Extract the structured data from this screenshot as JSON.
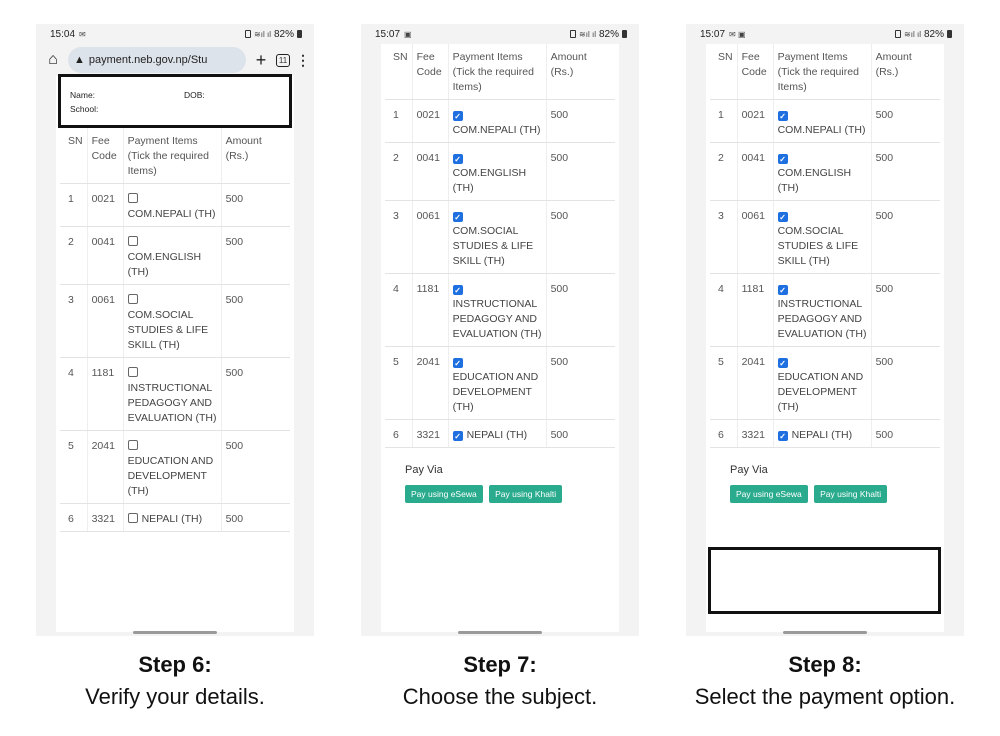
{
  "phone1": {
    "status": {
      "time": "15:04",
      "battery": "82%"
    },
    "browser": {
      "url": "payment.neb.gov.np/Stu",
      "tab_count": "11"
    },
    "info": {
      "name_label": "Name:",
      "dob_label": "DOB:",
      "school_label": "School:"
    },
    "table": {
      "headers": {
        "sn": "SN",
        "code": "Fee Code",
        "item": "Payment Items (Tick the required Items)",
        "amount": "Amount (Rs.)"
      },
      "rows": [
        {
          "sn": "1",
          "code": "0021",
          "item": "COM.NEPALI (TH)",
          "amount": "500",
          "checked": false
        },
        {
          "sn": "2",
          "code": "0041",
          "item": "COM.ENGLISH (TH)",
          "amount": "500",
          "checked": false
        },
        {
          "sn": "3",
          "code": "0061",
          "item": "COM.SOCIAL STUDIES & LIFE SKILL (TH)",
          "amount": "500",
          "checked": false
        },
        {
          "sn": "4",
          "code": "1181",
          "item": "INSTRUCTIONAL PEDAGOGY AND EVALUATION (TH)",
          "amount": "500",
          "checked": false
        },
        {
          "sn": "5",
          "code": "2041",
          "item": "EDUCATION AND DEVELOPMENT (TH)",
          "amount": "500",
          "checked": false
        },
        {
          "sn": "6",
          "code": "3321",
          "item": "NEPALI (TH)",
          "amount": "500",
          "checked": false
        }
      ]
    }
  },
  "phone2": {
    "status": {
      "time": "15:07",
      "battery": "82%"
    },
    "table": {
      "headers": {
        "sn": "SN",
        "code": "Fee Code",
        "item": "Payment Items (Tick the required Items)",
        "amount": "Amount (Rs.)"
      },
      "rows": [
        {
          "sn": "1",
          "code": "0021",
          "item": "COM.NEPALI (TH)",
          "amount": "500",
          "checked": true
        },
        {
          "sn": "2",
          "code": "0041",
          "item": "COM.ENGLISH (TH)",
          "amount": "500",
          "checked": true
        },
        {
          "sn": "3",
          "code": "0061",
          "item": "COM.SOCIAL STUDIES & LIFE SKILL (TH)",
          "amount": "500",
          "checked": true
        },
        {
          "sn": "4",
          "code": "1181",
          "item": "INSTRUCTIONAL PEDAGOGY AND EVALUATION (TH)",
          "amount": "500",
          "checked": true
        },
        {
          "sn": "5",
          "code": "2041",
          "item": "EDUCATION AND DEVELOPMENT (TH)",
          "amount": "500",
          "checked": true
        },
        {
          "sn": "6",
          "code": "3321",
          "item": "NEPALI (TH)",
          "amount": "500",
          "checked": true
        }
      ]
    },
    "pay_via": {
      "label": "Pay Via",
      "esewa": "Pay using eSewa",
      "khalti": "Pay using Khalti"
    }
  },
  "phone3": {
    "status": {
      "time": "15:07",
      "battery": "82%"
    },
    "table": {
      "headers": {
        "sn": "SN",
        "code": "Fee Code",
        "item": "Payment Items (Tick the required Items)",
        "amount": "Amount (Rs.)"
      },
      "rows": [
        {
          "sn": "1",
          "code": "0021",
          "item": "COM.NEPALI (TH)",
          "amount": "500",
          "checked": true
        },
        {
          "sn": "2",
          "code": "0041",
          "item": "COM.ENGLISH (TH)",
          "amount": "500",
          "checked": true
        },
        {
          "sn": "3",
          "code": "0061",
          "item": "COM.SOCIAL STUDIES & LIFE SKILL (TH)",
          "amount": "500",
          "checked": true
        },
        {
          "sn": "4",
          "code": "1181",
          "item": "INSTRUCTIONAL PEDAGOGY AND EVALUATION (TH)",
          "amount": "500",
          "checked": true
        },
        {
          "sn": "5",
          "code": "2041",
          "item": "EDUCATION AND DEVELOPMENT (TH)",
          "amount": "500",
          "checked": true
        },
        {
          "sn": "6",
          "code": "3321",
          "item": "NEPALI (TH)",
          "amount": "500",
          "checked": true
        }
      ]
    },
    "pay_via": {
      "label": "Pay Via",
      "esewa": "Pay using eSewa",
      "khalti": "Pay using Khalti"
    }
  },
  "captions": [
    {
      "title": "Step 6:",
      "desc": "Verify your details."
    },
    {
      "title": "Step 7:",
      "desc": "Choose the subject."
    },
    {
      "title": "Step 8:",
      "desc": "Select the payment option."
    }
  ],
  "colors": {
    "checkbox": "#1e6fe0",
    "pay_button": "#2aab8e",
    "highlight_border": "#111111"
  }
}
